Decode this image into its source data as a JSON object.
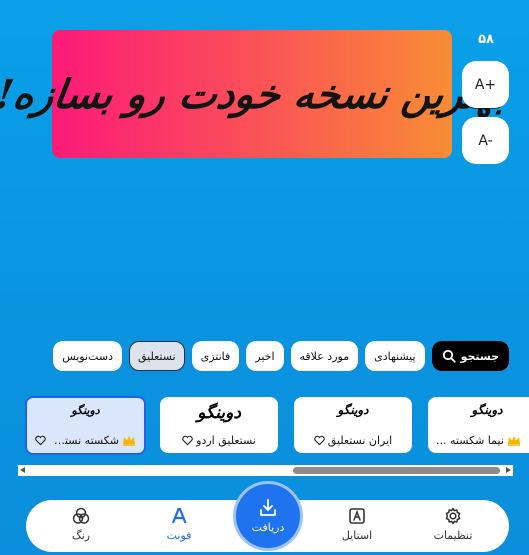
{
  "preview": {
    "text": "بهترین نسخه خودت رو بسازه!",
    "gradient_start": "#fb1a78",
    "gradient_end": "#f88d35"
  },
  "size_control": {
    "value": "۵۸",
    "increase_label": "A+",
    "decrease_label": "A-"
  },
  "filters": {
    "search_label": "جستجو",
    "chips": [
      {
        "label": "پیشنهادی",
        "selected": false
      },
      {
        "label": "مورد علاقه",
        "selected": false
      },
      {
        "label": "اخیر",
        "selected": false
      },
      {
        "label": "فانتزی",
        "selected": false
      },
      {
        "label": "نستعلیق",
        "selected": true
      },
      {
        "label": "دست‌نویس",
        "selected": false
      }
    ]
  },
  "fonts": [
    {
      "sample": "دوینگو",
      "name": "نیما شکسته ...",
      "premium": true,
      "selected": false
    },
    {
      "sample": "دوینگو",
      "name": "ایران نستعلیق",
      "premium": false,
      "selected": false
    },
    {
      "sample": "دوینگو",
      "name": "نستعلیق اردو",
      "premium": false,
      "selected": false
    },
    {
      "sample": "دوینگو",
      "name": "شکسته نستع...",
      "premium": true,
      "selected": true
    }
  ],
  "scrollbar": {
    "position": 0.62
  },
  "nav": {
    "settings": "تنظیمات",
    "style": "استایل",
    "download": "دریافت",
    "font": "فونت",
    "color": "رنگ"
  },
  "colors": {
    "background": "#0a9ae3",
    "accent": "#1f6de8",
    "crown": "#f2b705"
  }
}
